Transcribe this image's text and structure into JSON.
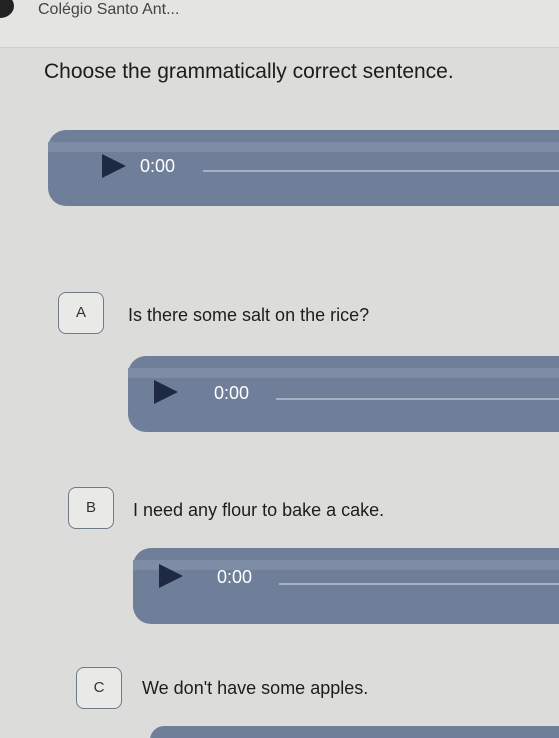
{
  "header": {
    "title": "Colégio Santo Ant..."
  },
  "question": {
    "text": "Choose the grammatically correct sentence."
  },
  "players": [
    {
      "time": "0:00"
    },
    {
      "time": "0:00"
    },
    {
      "time": "0:00"
    }
  ],
  "options": [
    {
      "letter": "A",
      "text": "Is there some salt on the rice?"
    },
    {
      "letter": "B",
      "text": "I need any flour to bake a cake."
    },
    {
      "letter": "C",
      "text": "We don't have some apples."
    }
  ],
  "colors": {
    "player_bg": "#6f7f99",
    "play_icon": "#1e2a44",
    "page_bg": "#dcdcda"
  },
  "icons": {
    "play": "play-icon",
    "logo": "school-logo"
  }
}
